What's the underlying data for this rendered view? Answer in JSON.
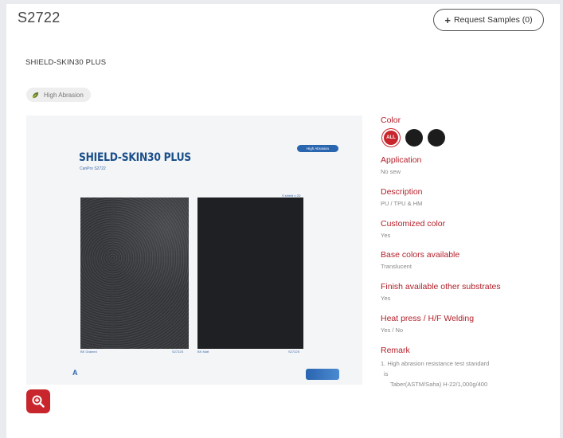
{
  "header": {
    "product_code": "S2722",
    "request_samples_label": "Request Samples (0)"
  },
  "product": {
    "name": "SHIELD-SKIN30 PLUS",
    "badge": "High Abrasion"
  },
  "image": {
    "title": "SHIELD-SKIN30 PLUS",
    "subtitle": "CanPro S2722",
    "tag": "High Abrasion",
    "top_label": "S.shield x 2D",
    "left_caption": "BK Grained",
    "left_code": "S2722S",
    "right_caption": "BK Matt",
    "right_code": "S2722S",
    "logo": "A"
  },
  "specs": {
    "color_label": "Color",
    "color_all": "ALL",
    "colors": [
      "#1c1c1c",
      "#1c1c1c"
    ],
    "application_label": "Application",
    "application_value": "No sew",
    "description_label": "Description",
    "description_value": "PU / TPU & HM",
    "customized_label": "Customized color",
    "customized_value": "Yes",
    "base_colors_label": "Base colors available",
    "base_colors_value": "Translucent",
    "finish_label": "Finish available other substrates",
    "finish_value": "Yes",
    "heat_press_label": "Heat press / H/F Welding",
    "heat_press_value": "Yes / No",
    "remark_label": "Remark",
    "remark_lines": [
      "1. High abrasion resistance test standard",
      "is",
      "Taber(ASTM/Saha) H-22/1,000g/400"
    ]
  },
  "accent_color": "#c8262c"
}
